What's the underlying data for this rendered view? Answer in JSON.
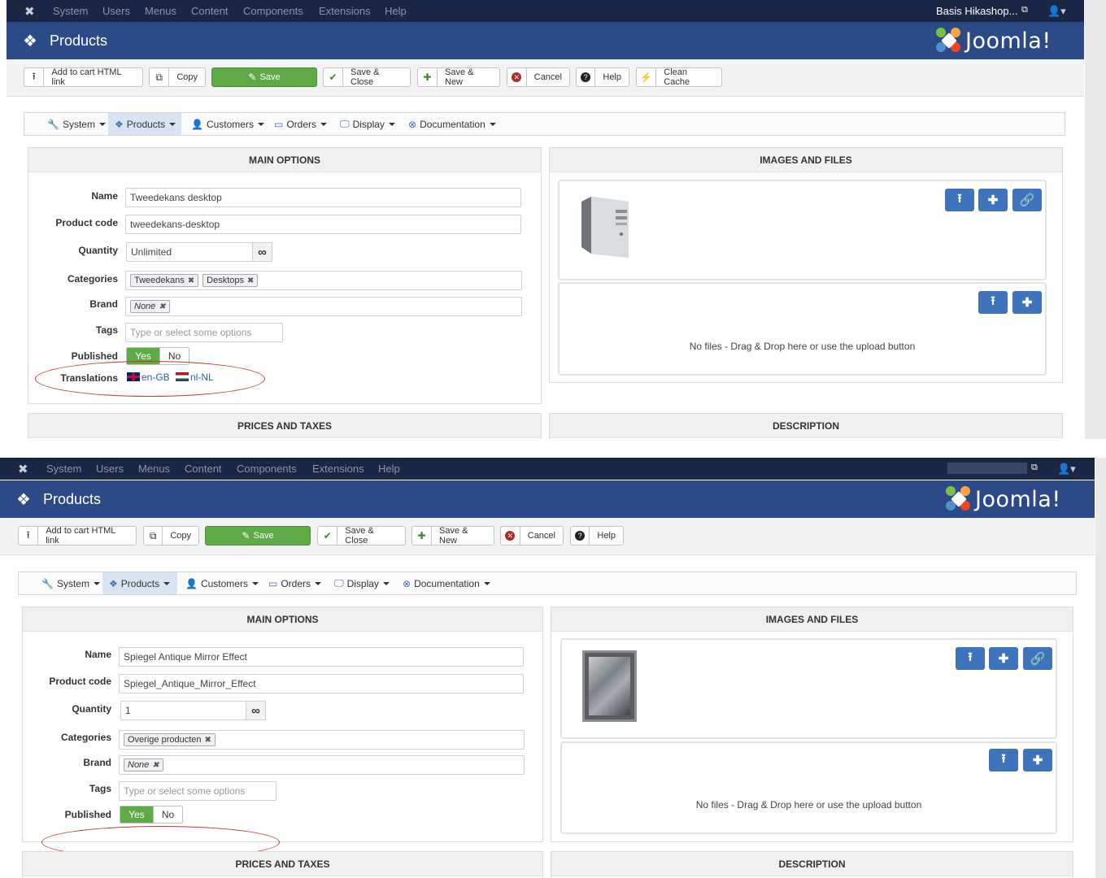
{
  "colors": {
    "topnav": "#1a2744",
    "header": "#2c4a87",
    "save": "#5fa947",
    "blue_button": "#3f74bd",
    "oval": "#c0392b"
  },
  "topnav": {
    "menus": [
      "System",
      "Users",
      "Menus",
      "Content",
      "Components",
      "Extensions",
      "Help"
    ],
    "user": "Basis Hikashop...",
    "joomla_icon": "joomla-x-icon",
    "user_icon": "user-icon"
  },
  "header": {
    "title": "Products",
    "logo_text": "Joomla!",
    "icon": "cubes-icon"
  },
  "toolbar": {
    "add_to_cart": "Add to cart HTML link",
    "copy": "Copy",
    "save": "Save",
    "save_close": "Save & Close",
    "save_new": "Save & New",
    "cancel": "Cancel",
    "help": "Help",
    "clean_cache": "Clean Cache"
  },
  "hikanav": [
    "System",
    "Products",
    "Customers",
    "Orders",
    "Display",
    "Documentation"
  ],
  "panels": {
    "main_options": "MAIN OPTIONS",
    "images_files": "IMAGES AND FILES",
    "prices_taxes": "PRICES AND TAXES",
    "description": "DESCRIPTION"
  },
  "labels": {
    "name": "Name",
    "product_code": "Product code",
    "quantity": "Quantity",
    "categories": "Categories",
    "brand": "Brand",
    "tags": "Tags",
    "published": "Published",
    "translations": "Translations",
    "yes": "Yes",
    "no": "No",
    "infinity": "∞",
    "no_files": "No files - Drag & Drop here or use the upload button"
  },
  "shot1": {
    "name": "Tweedekans desktop",
    "product_code": "tweedekans-desktop",
    "quantity": "Unlimited",
    "categories": [
      "Tweedekans",
      "Desktops"
    ],
    "brand": "None",
    "tags_placeholder": "Type or select some options",
    "translations": [
      "en-GB",
      "nl-NL"
    ]
  },
  "shot2": {
    "name": "Spiegel Antique Mirror Effect",
    "product_code": "Spiegel_Antique_Mirror_Effect",
    "quantity": "1",
    "categories": [
      "Overige producten"
    ],
    "brand": "None",
    "tags_placeholder": "Type or select some options"
  }
}
